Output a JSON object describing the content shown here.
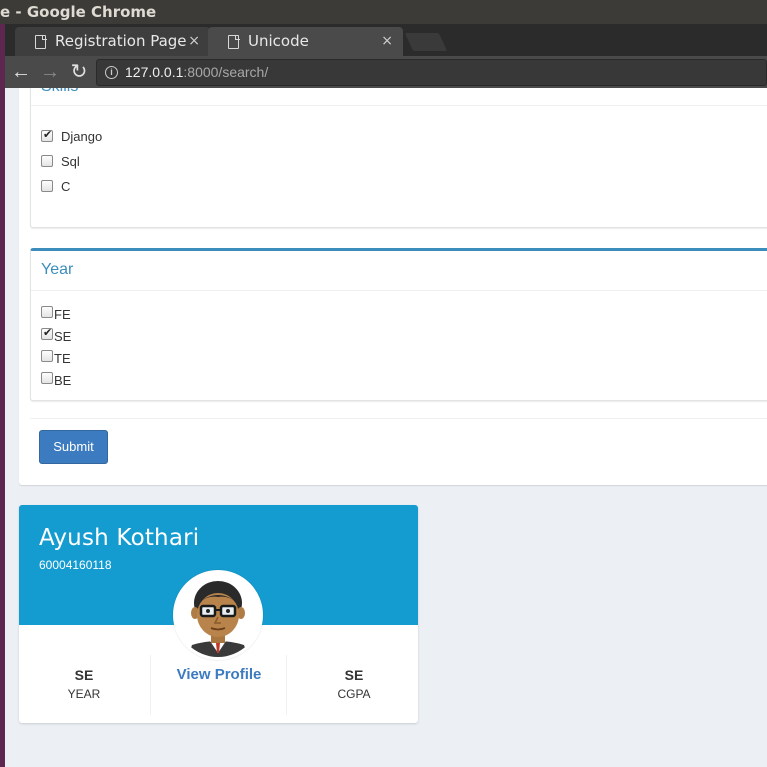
{
  "window": {
    "title": "e - Google Chrome"
  },
  "tabs": [
    {
      "label": "Registration Page",
      "close": "×"
    },
    {
      "label": "Unicode",
      "close": "×"
    }
  ],
  "toolbar": {
    "back": "←",
    "forward": "→",
    "reload": "↻",
    "url_host": "127.0.0.1",
    "url_path": ":8000/search/",
    "info_icon": "i"
  },
  "skills": {
    "title": "Skills",
    "options": [
      {
        "label": "Django",
        "checked": true
      },
      {
        "label": "Sql",
        "checked": false
      },
      {
        "label": "C",
        "checked": false
      }
    ]
  },
  "year": {
    "title": "Year",
    "options": [
      {
        "label": "FE",
        "checked": false
      },
      {
        "label": "SE",
        "checked": true
      },
      {
        "label": "TE",
        "checked": false
      },
      {
        "label": "BE",
        "checked": false
      }
    ]
  },
  "form": {
    "submit_label": "Submit"
  },
  "profile": {
    "name": "Ayush Kothari",
    "id_number": "60004160118",
    "year_value": "SE",
    "year_label": "YEAR",
    "view_profile_label": "View Profile",
    "cgpa_value": "SE",
    "cgpa_label": "CGPA"
  },
  "colors": {
    "accent": "#3c8dbc",
    "card_header": "#149cd1",
    "button": "#3c7bc0"
  }
}
